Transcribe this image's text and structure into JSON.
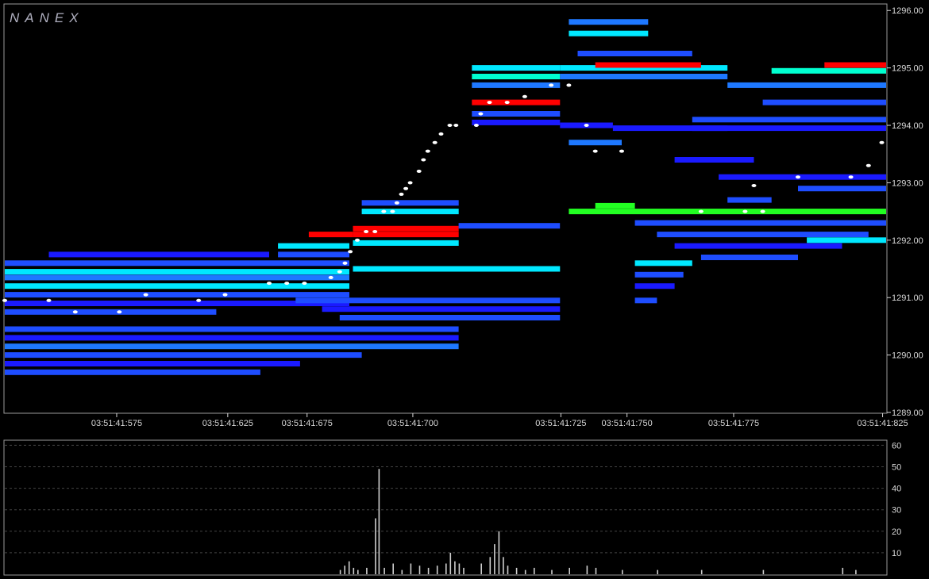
{
  "brand": "NANEX",
  "colors": {
    "background": "#000000",
    "frame": "#9a9a9a",
    "grid": "#444444",
    "deep_blue": "#1a1aff",
    "blue": "#1e4dff",
    "mid_blue": "#1e78ff",
    "cyan": "#00e8ff",
    "aqua": "#00ffd0",
    "red": "#ff0000",
    "green": "#22ff22",
    "white": "#ffffff",
    "volume_bar": "#cfcfcf"
  },
  "chart_data": [
    {
      "type": "heatmap",
      "title": "",
      "xlabel": "",
      "ylabel": "",
      "x_tick_labels": [
        "03:51:41:575",
        "03:51:41:625",
        "03:51:41:675",
        "03:51:41:700",
        "03:51:41:725",
        "03:51:41:750",
        "03:51:41:775",
        "03:51:41:825"
      ],
      "y_tick_labels": [
        "1296.00",
        "1295.00",
        "1294.00",
        "1293.00",
        "1292.00",
        "1291.00",
        "1290.00",
        "1289.00"
      ],
      "ylim": [
        1289.0,
        1296.1
      ],
      "grid": false,
      "x_ticks": [
        {
          "label": "03:51:41:575",
          "pos": 0.127
        },
        {
          "label": "03:51:41:625",
          "pos": 0.253
        },
        {
          "label": "03:51:41:675",
          "pos": 0.343
        },
        {
          "label": "03:51:41:700",
          "pos": 0.463
        },
        {
          "label": "03:51:41:725",
          "pos": 0.631
        },
        {
          "label": "03:51:41:750",
          "pos": 0.706
        },
        {
          "label": "03:51:41:775",
          "pos": 0.827
        },
        {
          "label": "03:51:41:825",
          "pos": 0.996
        }
      ],
      "bands": [
        {
          "x0": 0.0,
          "x1": 0.391,
          "p": 1291.6,
          "c": "blue"
        },
        {
          "x0": 0.0,
          "x1": 0.391,
          "p": 1291.45,
          "c": "cyan"
        },
        {
          "x0": 0.0,
          "x1": 0.391,
          "p": 1291.35,
          "c": "mid_blue"
        },
        {
          "x0": 0.0,
          "x1": 0.391,
          "p": 1291.2,
          "c": "cyan"
        },
        {
          "x0": 0.0,
          "x1": 0.391,
          "p": 1291.05,
          "c": "blue"
        },
        {
          "x0": 0.0,
          "x1": 0.391,
          "p": 1290.9,
          "c": "deep_blue"
        },
        {
          "x0": 0.0,
          "x1": 0.24,
          "p": 1290.75,
          "c": "blue"
        },
        {
          "x0": 0.0,
          "x1": 0.515,
          "p": 1290.45,
          "c": "blue"
        },
        {
          "x0": 0.0,
          "x1": 0.515,
          "p": 1290.3,
          "c": "deep_blue"
        },
        {
          "x0": 0.0,
          "x1": 0.515,
          "p": 1290.15,
          "c": "mid_blue"
        },
        {
          "x0": 0.0,
          "x1": 0.405,
          "p": 1290.0,
          "c": "blue"
        },
        {
          "x0": 0.0,
          "x1": 0.335,
          "p": 1289.85,
          "c": "deep_blue"
        },
        {
          "x0": 0.0,
          "x1": 0.29,
          "p": 1289.7,
          "c": "blue"
        },
        {
          "x0": 0.33,
          "x1": 0.63,
          "p": 1290.95,
          "c": "blue"
        },
        {
          "x0": 0.36,
          "x1": 0.63,
          "p": 1290.8,
          "c": "deep_blue"
        },
        {
          "x0": 0.38,
          "x1": 0.63,
          "p": 1290.65,
          "c": "blue"
        },
        {
          "x0": 0.31,
          "x1": 0.391,
          "p": 1291.75,
          "c": "blue"
        },
        {
          "x0": 0.31,
          "x1": 0.391,
          "p": 1291.9,
          "c": "cyan"
        },
        {
          "x0": 0.05,
          "x1": 0.3,
          "p": 1291.75,
          "c": "deep_blue"
        },
        {
          "x0": 0.395,
          "x1": 0.63,
          "p": 1291.5,
          "c": "cyan"
        },
        {
          "x0": 0.395,
          "x1": 0.515,
          "p": 1291.95,
          "c": "cyan"
        },
        {
          "x0": 0.395,
          "x1": 0.515,
          "p": 1292.1,
          "c": "red"
        },
        {
          "x0": 0.395,
          "x1": 0.515,
          "p": 1292.2,
          "c": "red"
        },
        {
          "x0": 0.345,
          "x1": 0.395,
          "p": 1292.1,
          "c": "red"
        },
        {
          "x0": 0.405,
          "x1": 0.515,
          "p": 1292.5,
          "c": "cyan"
        },
        {
          "x0": 0.405,
          "x1": 0.515,
          "p": 1292.65,
          "c": "blue"
        },
        {
          "x0": 0.515,
          "x1": 0.63,
          "p": 1292.25,
          "c": "blue"
        },
        {
          "x0": 0.53,
          "x1": 0.63,
          "p": 1295.0,
          "c": "cyan"
        },
        {
          "x0": 0.53,
          "x1": 0.63,
          "p": 1294.85,
          "c": "aqua"
        },
        {
          "x0": 0.53,
          "x1": 0.63,
          "p": 1294.7,
          "c": "mid_blue"
        },
        {
          "x0": 0.53,
          "x1": 0.63,
          "p": 1294.4,
          "c": "red"
        },
        {
          "x0": 0.53,
          "x1": 0.63,
          "p": 1294.2,
          "c": "blue"
        },
        {
          "x0": 0.53,
          "x1": 0.63,
          "p": 1294.05,
          "c": "deep_blue"
        },
        {
          "x0": 0.63,
          "x1": 0.69,
          "p": 1294.0,
          "c": "deep_blue"
        },
        {
          "x0": 0.63,
          "x1": 0.82,
          "p": 1294.85,
          "c": "mid_blue"
        },
        {
          "x0": 0.63,
          "x1": 0.82,
          "p": 1295.0,
          "c": "cyan"
        },
        {
          "x0": 0.64,
          "x1": 0.73,
          "p": 1295.6,
          "c": "cyan"
        },
        {
          "x0": 0.64,
          "x1": 0.73,
          "p": 1295.8,
          "c": "mid_blue"
        },
        {
          "x0": 0.65,
          "x1": 0.78,
          "p": 1295.25,
          "c": "blue"
        },
        {
          "x0": 0.67,
          "x1": 0.79,
          "p": 1295.05,
          "c": "red"
        },
        {
          "x0": 0.64,
          "x1": 0.7,
          "p": 1293.7,
          "c": "mid_blue"
        },
        {
          "x0": 0.69,
          "x1": 0.82,
          "p": 1293.95,
          "c": "deep_blue"
        },
        {
          "x0": 0.78,
          "x1": 1.0,
          "p": 1294.1,
          "c": "blue"
        },
        {
          "x0": 0.78,
          "x1": 1.0,
          "p": 1293.95,
          "c": "deep_blue"
        },
        {
          "x0": 0.82,
          "x1": 1.0,
          "p": 1294.7,
          "c": "mid_blue"
        },
        {
          "x0": 0.86,
          "x1": 1.0,
          "p": 1294.4,
          "c": "blue"
        },
        {
          "x0": 0.87,
          "x1": 1.0,
          "p": 1294.95,
          "c": "aqua"
        },
        {
          "x0": 0.93,
          "x1": 1.0,
          "p": 1295.05,
          "c": "red"
        },
        {
          "x0": 0.64,
          "x1": 1.0,
          "p": 1292.5,
          "c": "green"
        },
        {
          "x0": 0.67,
          "x1": 0.715,
          "p": 1292.6,
          "c": "green"
        },
        {
          "x0": 0.715,
          "x1": 1.0,
          "p": 1292.3,
          "c": "blue"
        },
        {
          "x0": 0.74,
          "x1": 0.98,
          "p": 1292.1,
          "c": "blue"
        },
        {
          "x0": 0.76,
          "x1": 0.95,
          "p": 1291.9,
          "c": "deep_blue"
        },
        {
          "x0": 0.79,
          "x1": 0.9,
          "p": 1291.7,
          "c": "blue"
        },
        {
          "x0": 0.715,
          "x1": 0.78,
          "p": 1291.6,
          "c": "cyan"
        },
        {
          "x0": 0.715,
          "x1": 0.77,
          "p": 1291.4,
          "c": "blue"
        },
        {
          "x0": 0.715,
          "x1": 0.76,
          "p": 1291.2,
          "c": "deep_blue"
        },
        {
          "x0": 0.715,
          "x1": 0.74,
          "p": 1290.95,
          "c": "blue"
        },
        {
          "x0": 0.81,
          "x1": 1.0,
          "p": 1293.1,
          "c": "deep_blue"
        },
        {
          "x0": 0.82,
          "x1": 0.87,
          "p": 1292.7,
          "c": "blue"
        },
        {
          "x0": 0.9,
          "x1": 1.0,
          "p": 1292.9,
          "c": "blue"
        },
        {
          "x0": 0.76,
          "x1": 0.85,
          "p": 1293.4,
          "c": "deep_blue"
        },
        {
          "x0": 0.91,
          "x1": 1.0,
          "p": 1292.0,
          "c": "cyan"
        }
      ],
      "trades": [
        {
          "x": 0.0,
          "p": 1290.95
        },
        {
          "x": 0.05,
          "p": 1290.95
        },
        {
          "x": 0.08,
          "p": 1290.75
        },
        {
          "x": 0.13,
          "p": 1290.75
        },
        {
          "x": 0.16,
          "p": 1291.05
        },
        {
          "x": 0.22,
          "p": 1290.95
        },
        {
          "x": 0.25,
          "p": 1291.05
        },
        {
          "x": 0.3,
          "p": 1291.25
        },
        {
          "x": 0.32,
          "p": 1291.25
        },
        {
          "x": 0.34,
          "p": 1291.25
        },
        {
          "x": 0.37,
          "p": 1291.35
        },
        {
          "x": 0.38,
          "p": 1291.45
        },
        {
          "x": 0.386,
          "p": 1291.6
        },
        {
          "x": 0.392,
          "p": 1291.8
        },
        {
          "x": 0.4,
          "p": 1292.0
        },
        {
          "x": 0.41,
          "p": 1292.15
        },
        {
          "x": 0.42,
          "p": 1292.15
        },
        {
          "x": 0.43,
          "p": 1292.5
        },
        {
          "x": 0.44,
          "p": 1292.5
        },
        {
          "x": 0.445,
          "p": 1292.65
        },
        {
          "x": 0.45,
          "p": 1292.8
        },
        {
          "x": 0.455,
          "p": 1292.9
        },
        {
          "x": 0.46,
          "p": 1293.0
        },
        {
          "x": 0.47,
          "p": 1293.2
        },
        {
          "x": 0.475,
          "p": 1293.4
        },
        {
          "x": 0.48,
          "p": 1293.55
        },
        {
          "x": 0.488,
          "p": 1293.7
        },
        {
          "x": 0.495,
          "p": 1293.85
        },
        {
          "x": 0.505,
          "p": 1294.0
        },
        {
          "x": 0.512,
          "p": 1294.0
        },
        {
          "x": 0.535,
          "p": 1294.0
        },
        {
          "x": 0.54,
          "p": 1294.2
        },
        {
          "x": 0.55,
          "p": 1294.4
        },
        {
          "x": 0.57,
          "p": 1294.4
        },
        {
          "x": 0.59,
          "p": 1294.5
        },
        {
          "x": 0.62,
          "p": 1294.7
        },
        {
          "x": 0.64,
          "p": 1294.7
        },
        {
          "x": 0.66,
          "p": 1294.0
        },
        {
          "x": 0.67,
          "p": 1293.55
        },
        {
          "x": 0.7,
          "p": 1293.55
        },
        {
          "x": 0.79,
          "p": 1292.5
        },
        {
          "x": 0.84,
          "p": 1292.5
        },
        {
          "x": 0.86,
          "p": 1292.5
        },
        {
          "x": 0.85,
          "p": 1292.95
        },
        {
          "x": 0.9,
          "p": 1293.1
        },
        {
          "x": 0.96,
          "p": 1293.1
        },
        {
          "x": 0.98,
          "p": 1293.3
        },
        {
          "x": 0.995,
          "p": 1293.7
        }
      ]
    },
    {
      "type": "bar",
      "title": "",
      "xlabel": "",
      "ylabel": "",
      "y_tick_labels": [
        "60",
        "50",
        "40",
        "30",
        "20",
        "10"
      ],
      "ylim": [
        0,
        62
      ],
      "grid": true,
      "bars": [
        {
          "x": 0.38,
          "v": 2
        },
        {
          "x": 0.385,
          "v": 4
        },
        {
          "x": 0.39,
          "v": 6
        },
        {
          "x": 0.395,
          "v": 3
        },
        {
          "x": 0.4,
          "v": 2
        },
        {
          "x": 0.41,
          "v": 3
        },
        {
          "x": 0.42,
          "v": 26
        },
        {
          "x": 0.424,
          "v": 49
        },
        {
          "x": 0.43,
          "v": 3
        },
        {
          "x": 0.44,
          "v": 5
        },
        {
          "x": 0.45,
          "v": 2
        },
        {
          "x": 0.46,
          "v": 5
        },
        {
          "x": 0.47,
          "v": 4
        },
        {
          "x": 0.48,
          "v": 3
        },
        {
          "x": 0.49,
          "v": 4
        },
        {
          "x": 0.5,
          "v": 5
        },
        {
          "x": 0.505,
          "v": 10
        },
        {
          "x": 0.51,
          "v": 6
        },
        {
          "x": 0.515,
          "v": 5
        },
        {
          "x": 0.52,
          "v": 3
        },
        {
          "x": 0.54,
          "v": 5
        },
        {
          "x": 0.55,
          "v": 8
        },
        {
          "x": 0.555,
          "v": 14
        },
        {
          "x": 0.56,
          "v": 20
        },
        {
          "x": 0.565,
          "v": 8
        },
        {
          "x": 0.57,
          "v": 4
        },
        {
          "x": 0.58,
          "v": 3
        },
        {
          "x": 0.59,
          "v": 2
        },
        {
          "x": 0.6,
          "v": 3
        },
        {
          "x": 0.62,
          "v": 2
        },
        {
          "x": 0.64,
          "v": 3
        },
        {
          "x": 0.66,
          "v": 4
        },
        {
          "x": 0.67,
          "v": 3
        },
        {
          "x": 0.7,
          "v": 2
        },
        {
          "x": 0.74,
          "v": 2
        },
        {
          "x": 0.79,
          "v": 2
        },
        {
          "x": 0.86,
          "v": 2
        },
        {
          "x": 0.95,
          "v": 3
        },
        {
          "x": 0.965,
          "v": 2
        }
      ]
    }
  ]
}
